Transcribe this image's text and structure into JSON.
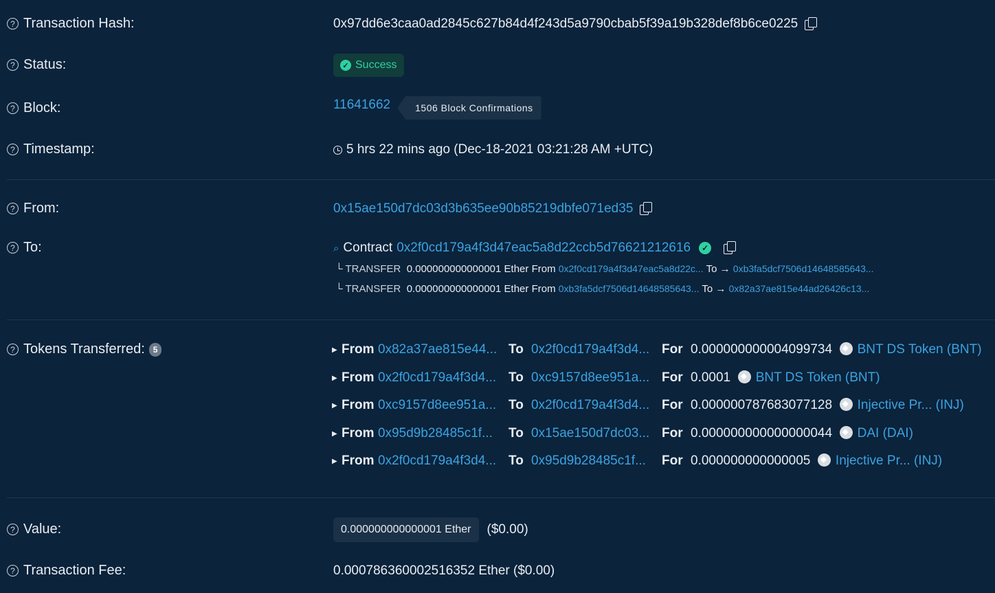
{
  "hash": {
    "label": "Transaction Hash:",
    "value": "0x97dd6e3caa0ad2845c627b84d4f243d5a9790cbab5f39a19b328def8b6ce0225"
  },
  "status": {
    "label": "Status:",
    "value": "Success"
  },
  "block": {
    "label": "Block:",
    "number": "11641662",
    "confirmations": "1506 Block Confirmations"
  },
  "timestamp": {
    "label": "Timestamp:",
    "value": "5 hrs 22 mins ago (Dec-18-2021 03:21:28 AM +UTC)"
  },
  "from": {
    "label": "From:",
    "value": "0x15ae150d7dc03d3b635ee90b85219dbfe071ed35"
  },
  "to": {
    "label": "To:",
    "contract_word": "Contract",
    "contract": "0x2f0cd179a4f3d47eac5a8d22ccb5d76621212616",
    "transfers": [
      {
        "prefix": "└ TRANSFER",
        "amount": "0.000000000000001 Ether",
        "from_word": "From",
        "from": "0x2f0cd179a4f3d47eac5a8d22c...",
        "to_word": "To →",
        "to": "0xb3fa5dcf7506d14648585643..."
      },
      {
        "prefix": "└ TRANSFER",
        "amount": "0.000000000000001 Ether",
        "from_word": "From",
        "from": "0xb3fa5dcf7506d14648585643...",
        "to_word": "To →",
        "to": "0x82a37ae815e44ad26426c13..."
      }
    ]
  },
  "tokens": {
    "label": "Tokens Transferred:",
    "count": "5",
    "from_word": "From",
    "to_word": "To",
    "for_word": "For",
    "rows": [
      {
        "from": "0x82a37ae815e44...",
        "to": "0x2f0cd179a4f3d4...",
        "amount": "0.000000000004099734",
        "token": "BNT DS Token (BNT)"
      },
      {
        "from": "0x2f0cd179a4f3d4...",
        "to": "0xc9157d8ee951a...",
        "amount": "0.0001",
        "token": "BNT DS Token (BNT)"
      },
      {
        "from": "0xc9157d8ee951a...",
        "to": "0x2f0cd179a4f3d4...",
        "amount": "0.000000787683077128",
        "token": "Injective Pr... (INJ)"
      },
      {
        "from": "0x95d9b28485c1f...",
        "to": "0x15ae150d7dc03...",
        "amount": "0.000000000000000044",
        "token": "DAI (DAI)"
      },
      {
        "from": "0x2f0cd179a4f3d4...",
        "to": "0x95d9b28485c1f...",
        "amount": "0.000000000000005",
        "token": "Injective Pr... (INJ)"
      }
    ]
  },
  "value": {
    "label": "Value:",
    "amount": "0.000000000000001 Ether",
    "usd": "($0.00)"
  },
  "fee": {
    "label": "Transaction Fee:",
    "value": "0.000786360002516352 Ether ($0.00)"
  },
  "colors": {
    "background": "#0b233b",
    "link": "#3ca2e0",
    "success": "#2fd0a1"
  }
}
